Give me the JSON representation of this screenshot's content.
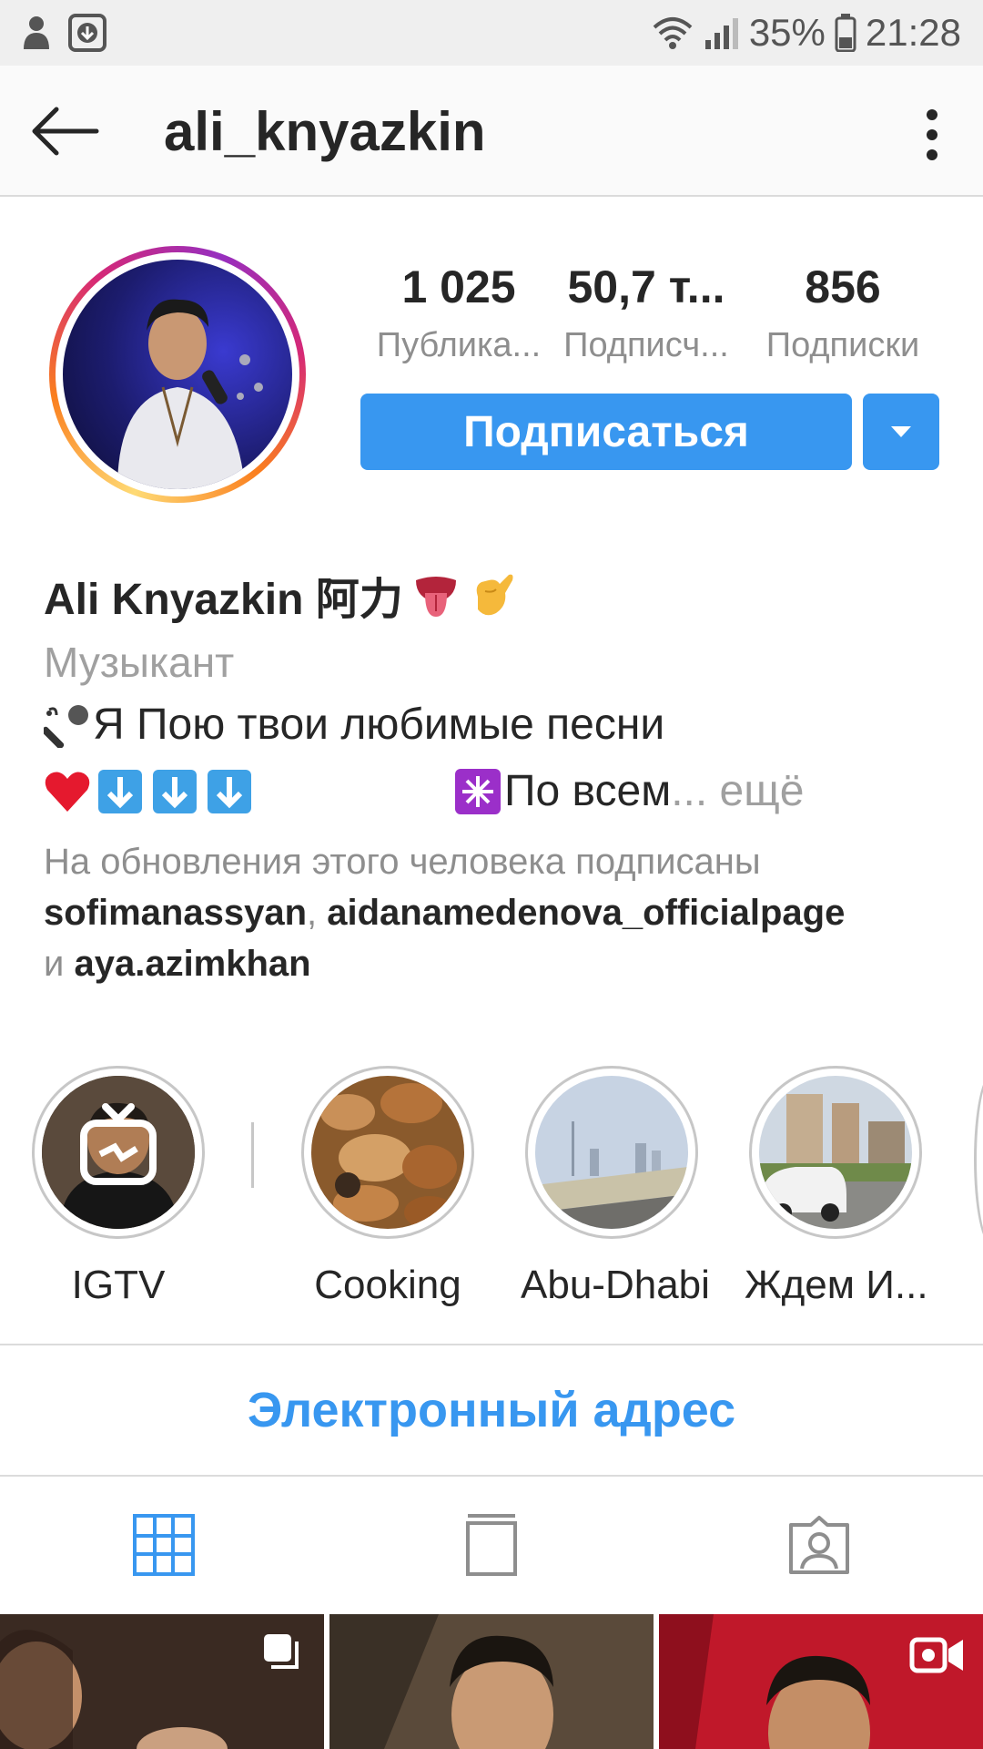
{
  "status_bar": {
    "battery": "35%",
    "time": "21:28",
    "icons": [
      "notification-icon",
      "download-icon",
      "wifi-icon",
      "signal-icon",
      "battery-icon"
    ]
  },
  "header": {
    "username": "ali_knyazkin",
    "icons": [
      "back-arrow-icon",
      "more-vert-icon"
    ]
  },
  "profile": {
    "stats": [
      {
        "value": "1 025",
        "label": "Публика..."
      },
      {
        "value": "50,7 т...",
        "label": "Подписч..."
      },
      {
        "value": "856",
        "label": "Подписки"
      }
    ],
    "follow_label": "Подписаться",
    "accent_color": "#3897f0"
  },
  "bio": {
    "name": "Ali Knyazkin 阿力",
    "category": "Музыкант",
    "line1": "Я Пою твои любимые песни",
    "line2_text": "По всем",
    "line2_ellipsis": "...",
    "more_label": " ещё",
    "followed_by_prefix": "На обновления этого человека подписаны ",
    "followed_by_user1": "sofimanassyan",
    "followed_by_sep": ", ",
    "followed_by_user2": "aidanamedenova_officialpage",
    "followed_by_and": "и ",
    "followed_by_user3": "aya.azimkhan"
  },
  "highlights": [
    {
      "label": "IGTV"
    },
    {
      "label": "Cooking"
    },
    {
      "label": "Abu-Dhabi"
    },
    {
      "label": "Ждем И..."
    }
  ],
  "contact": {
    "label": "Электронный адрес"
  },
  "tabs": [
    {
      "icon": "grid-icon",
      "active": true
    },
    {
      "icon": "feed-icon",
      "active": false
    },
    {
      "icon": "tagged-icon",
      "active": false
    }
  ]
}
